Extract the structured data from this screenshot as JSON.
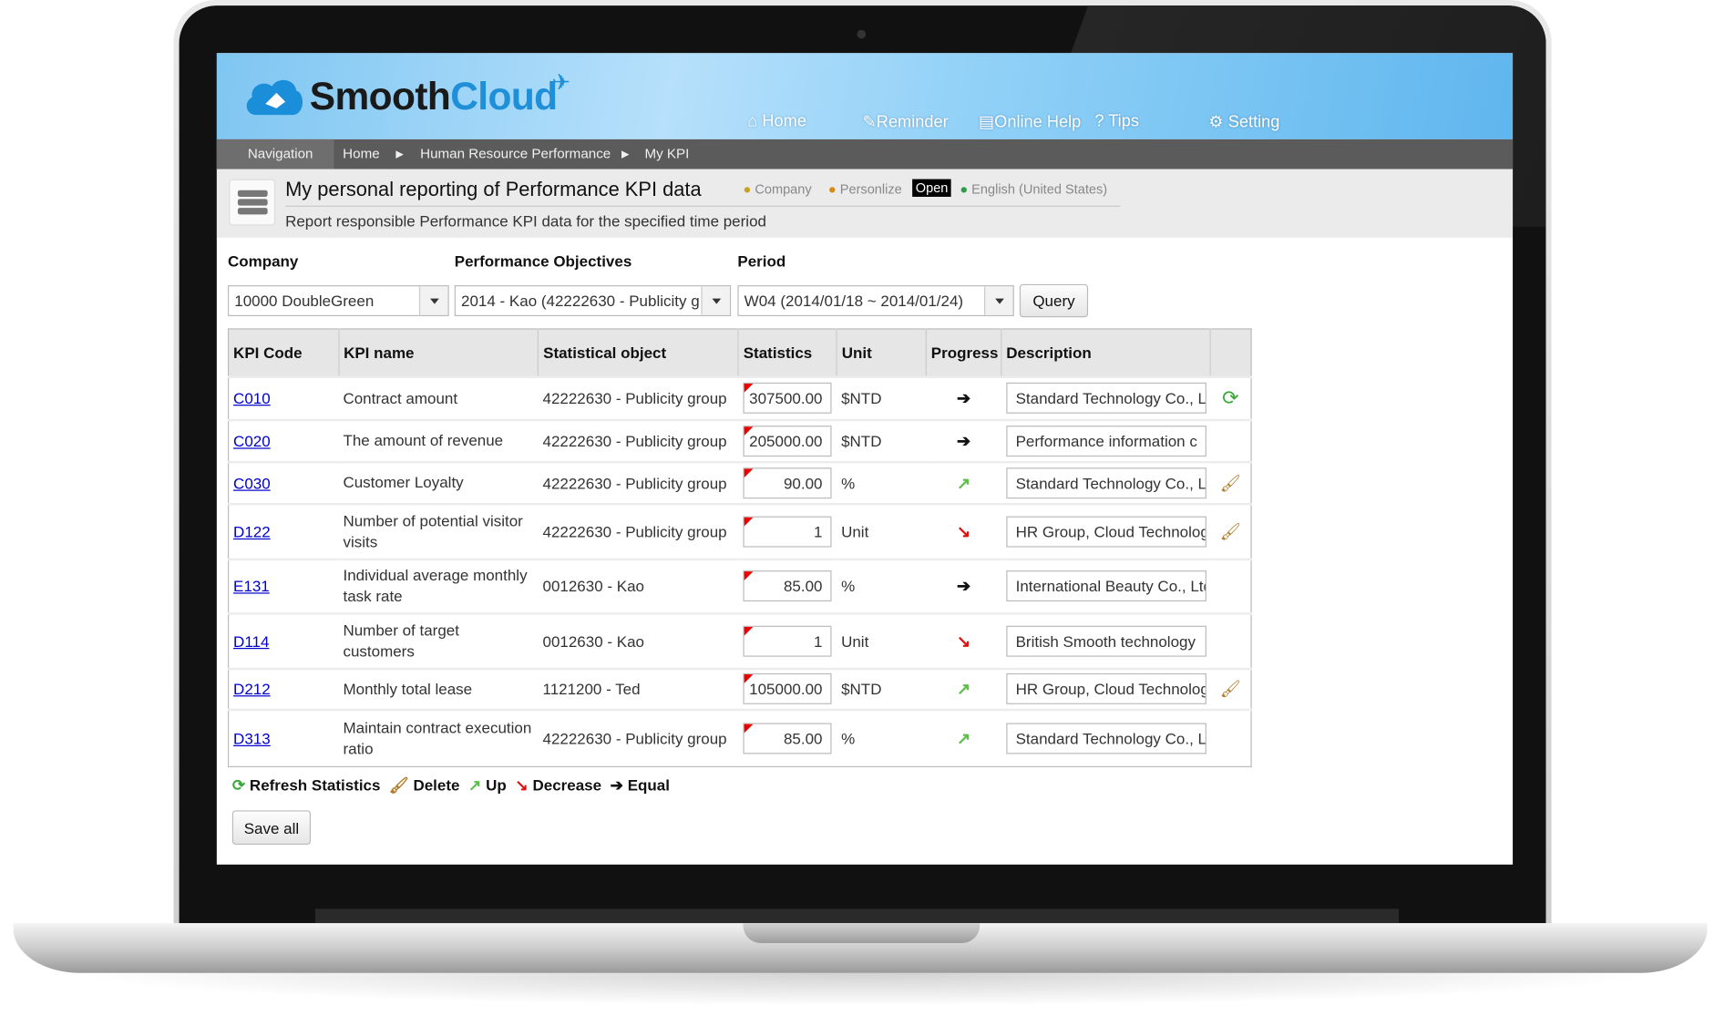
{
  "app": {
    "logo_main": "Smooth",
    "logo_accent": "Cloud"
  },
  "nav": [
    {
      "label": "Home",
      "icon": "home-icon"
    },
    {
      "label": "Reminder",
      "icon": "reminder-icon"
    },
    {
      "label": "Online Help",
      "icon": "help-book-icon"
    },
    {
      "label": "Tips",
      "icon": "question-icon"
    },
    {
      "label": "Setting",
      "icon": "setting-icon"
    }
  ],
  "breadcrumb": {
    "label": "Navigation",
    "items": [
      "Home",
      "Human Resource Performance",
      "My KPI"
    ]
  },
  "page": {
    "title": "My personal reporting of Performance KPI data",
    "company": "Company",
    "personalize": "Personlize",
    "open": "Open",
    "language": "English (United States)",
    "subtitle": "Report responsible Performance KPI data for the specified time period"
  },
  "filters": {
    "company_label": "Company",
    "company_value": "10000 DoubleGreen",
    "objectives_label": "Performance Objectives",
    "objectives_value": "2014 - Kao (42222630 - Publicity g",
    "period_label": "Period",
    "period_value": "W04 (2014/01/18 ~ 2014/01/24)",
    "query": "Query"
  },
  "table": {
    "headers": [
      "KPI Code",
      "KPI name",
      "Statistical object",
      "Statistics",
      "Unit",
      "Progress",
      "Description"
    ],
    "rows": [
      {
        "code": "C010",
        "name": "Contract amount",
        "object": "42222630 - Publicity group",
        "stat": "307500.00",
        "unit": "$NTD",
        "progress": "equal",
        "desc": "Standard Technology Co., Ltd",
        "action": "refresh"
      },
      {
        "code": "C020",
        "name": "The amount of revenue",
        "object": "42222630 - Publicity group",
        "stat": "205000.00",
        "unit": "$NTD",
        "progress": "equal",
        "desc": "Performance information c",
        "action": ""
      },
      {
        "code": "C030",
        "name": "Customer Loyalty",
        "object": "42222630 - Publicity group",
        "stat": "90.00",
        "unit": "%",
        "progress": "up",
        "desc": "Standard Technology Co., Ltd",
        "action": "delete"
      },
      {
        "code": "D122",
        "name": "Number of potential visitor visits",
        "object": "42222630 - Publicity group",
        "stat": "1",
        "unit": "Unit",
        "progress": "decrease",
        "desc": "HR Group, Cloud Technology",
        "action": "delete"
      },
      {
        "code": "E131",
        "name": "Individual average monthly task rate",
        "object": "0012630 - Kao",
        "stat": "85.00",
        "unit": "%",
        "progress": "equal",
        "desc": "International Beauty Co., Ltd",
        "action": ""
      },
      {
        "code": "D114",
        "name": "Number of target customers",
        "object": "0012630 - Kao",
        "stat": "1",
        "unit": "Unit",
        "progress": "decrease",
        "desc": "British Smooth technology",
        "action": ""
      },
      {
        "code": "D212",
        "name": "Monthly total lease",
        "object": "1121200 - Ted",
        "stat": "105000.00",
        "unit": "$NTD",
        "progress": "up",
        "desc": "HR Group, Cloud Technology",
        "action": "delete"
      },
      {
        "code": "D313",
        "name": "Maintain contract execution ratio",
        "object": "42222630 - Publicity group",
        "stat": "85.00",
        "unit": "%",
        "progress": "up",
        "desc": "Standard Technology Co., Ltd",
        "action": ""
      }
    ]
  },
  "legend": {
    "refresh": "Refresh Statistics",
    "delete": "Delete",
    "up": "Up",
    "decrease": "Decrease",
    "equal": "Equal"
  },
  "save_all": "Save all",
  "colors": {
    "header_blue": "#7fc6f2",
    "up": "#5cbf4a",
    "decrease": "#e01010",
    "equal": "#111111",
    "link": "#0000cc"
  }
}
